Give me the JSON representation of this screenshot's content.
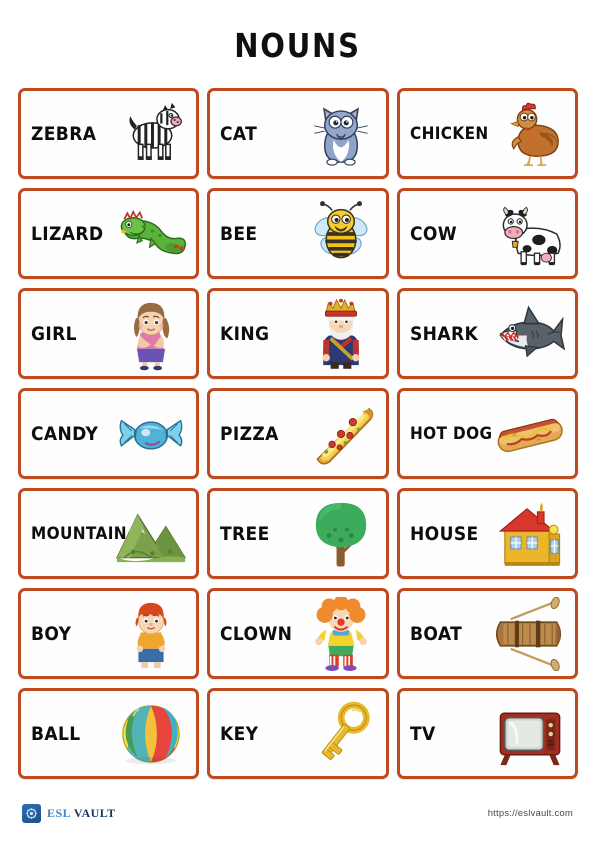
{
  "document": {
    "title": "NOUNS"
  },
  "grid": {
    "rows": [
      [
        {
          "word": "ZEBRA",
          "icon": "zebra-illustration"
        },
        {
          "word": "CAT",
          "icon": "cat-illustration"
        },
        {
          "word": "CHICKEN",
          "icon": "chicken-illustration"
        }
      ],
      [
        {
          "word": "LIZARD",
          "icon": "lizard-illustration"
        },
        {
          "word": "BEE",
          "icon": "bee-illustration"
        },
        {
          "word": "COW",
          "icon": "cow-illustration"
        }
      ],
      [
        {
          "word": "GIRL",
          "icon": "girl-illustration"
        },
        {
          "word": "KING",
          "icon": "king-illustration"
        },
        {
          "word": "SHARK",
          "icon": "shark-illustration"
        }
      ],
      [
        {
          "word": "CANDY",
          "icon": "candy-illustration"
        },
        {
          "word": "PIZZA",
          "icon": "pizza-illustration"
        },
        {
          "word": "HOT DOG",
          "icon": "hot-dog-illustration"
        }
      ],
      [
        {
          "word": "MOUNTAIN",
          "icon": "mountain-illustration"
        },
        {
          "word": "TREE",
          "icon": "tree-illustration"
        },
        {
          "word": "HOUSE",
          "icon": "house-illustration"
        }
      ],
      [
        {
          "word": "BOY",
          "icon": "boy-illustration"
        },
        {
          "word": "CLOWN",
          "icon": "clown-illustration"
        },
        {
          "word": "BOAT",
          "icon": "boat-illustration"
        }
      ],
      [
        {
          "word": "BALL",
          "icon": "ball-illustration"
        },
        {
          "word": "KEY",
          "icon": "key-illustration"
        },
        {
          "word": "TV",
          "icon": "tv-illustration"
        }
      ]
    ]
  },
  "footer": {
    "brand_primary": "ESL",
    "brand_secondary": "VAULT",
    "url": "https://eslvault.com"
  },
  "colors": {
    "card_border": "#bf4a20",
    "title_text": "#101010",
    "brand_light": "#3f86c4",
    "brand_dark": "#14365e"
  }
}
